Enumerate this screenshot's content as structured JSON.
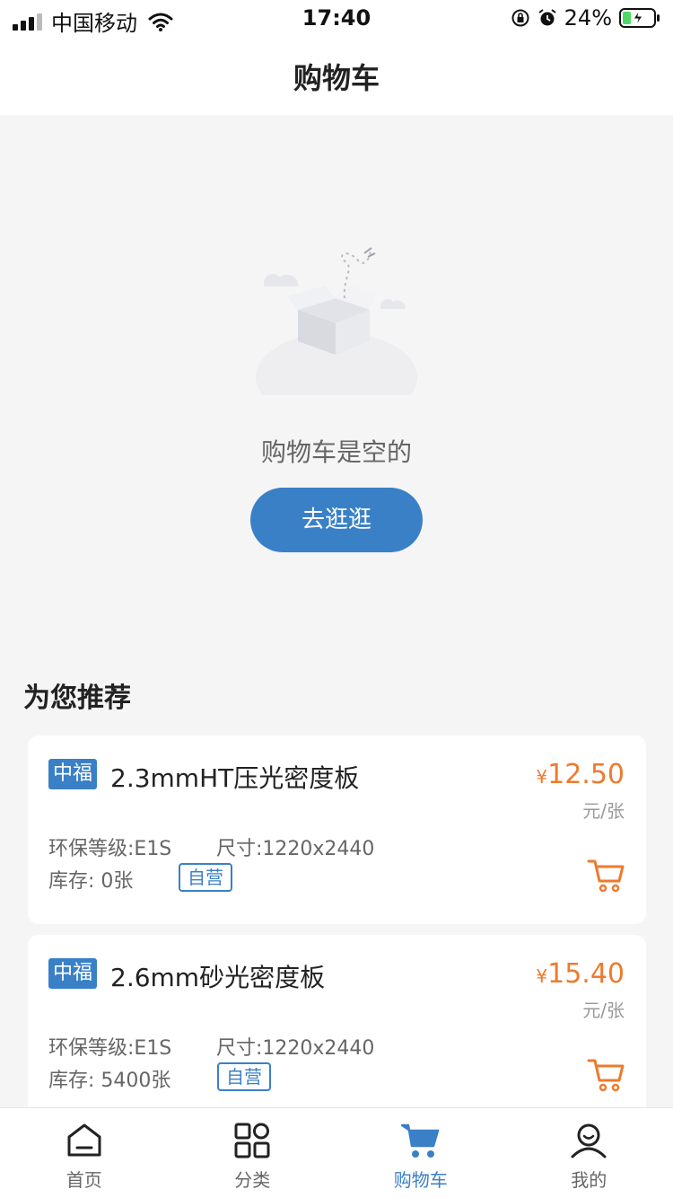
{
  "status_bar": {
    "carrier": "中国移动",
    "time": "17:40",
    "battery": "24%"
  },
  "nav": {
    "title": "购物车"
  },
  "empty": {
    "message": "购物车是空的",
    "button_label": "去逛逛"
  },
  "recommend": {
    "title": "为您推荐",
    "products": [
      {
        "brand": "中福",
        "name": "2.3mmHT压光密度板",
        "currency": "¥",
        "price": "12.50",
        "unit": "元/张",
        "spec_grade": "环保等级:E1S",
        "spec_size": "尺寸:1220x2440",
        "stock": "库存: 0张",
        "tag": "自营"
      },
      {
        "brand": "中福",
        "name": "2.6mm砂光密度板",
        "currency": "¥",
        "price": "15.40",
        "unit": "元/张",
        "spec_grade": "环保等级:E1S",
        "spec_size": "尺寸:1220x2440",
        "stock": "库存: 5400张",
        "tag": "自营"
      }
    ]
  },
  "tabs": [
    {
      "label": "首页",
      "icon": "home-icon",
      "active": false
    },
    {
      "label": "分类",
      "icon": "category-icon",
      "active": false
    },
    {
      "label": "购物车",
      "icon": "cart-icon",
      "active": true
    },
    {
      "label": "我的",
      "icon": "profile-icon",
      "active": false
    }
  ],
  "colors": {
    "accent": "#3a80c7",
    "price": "#ee7a2e",
    "background": "#f5f5f5"
  }
}
